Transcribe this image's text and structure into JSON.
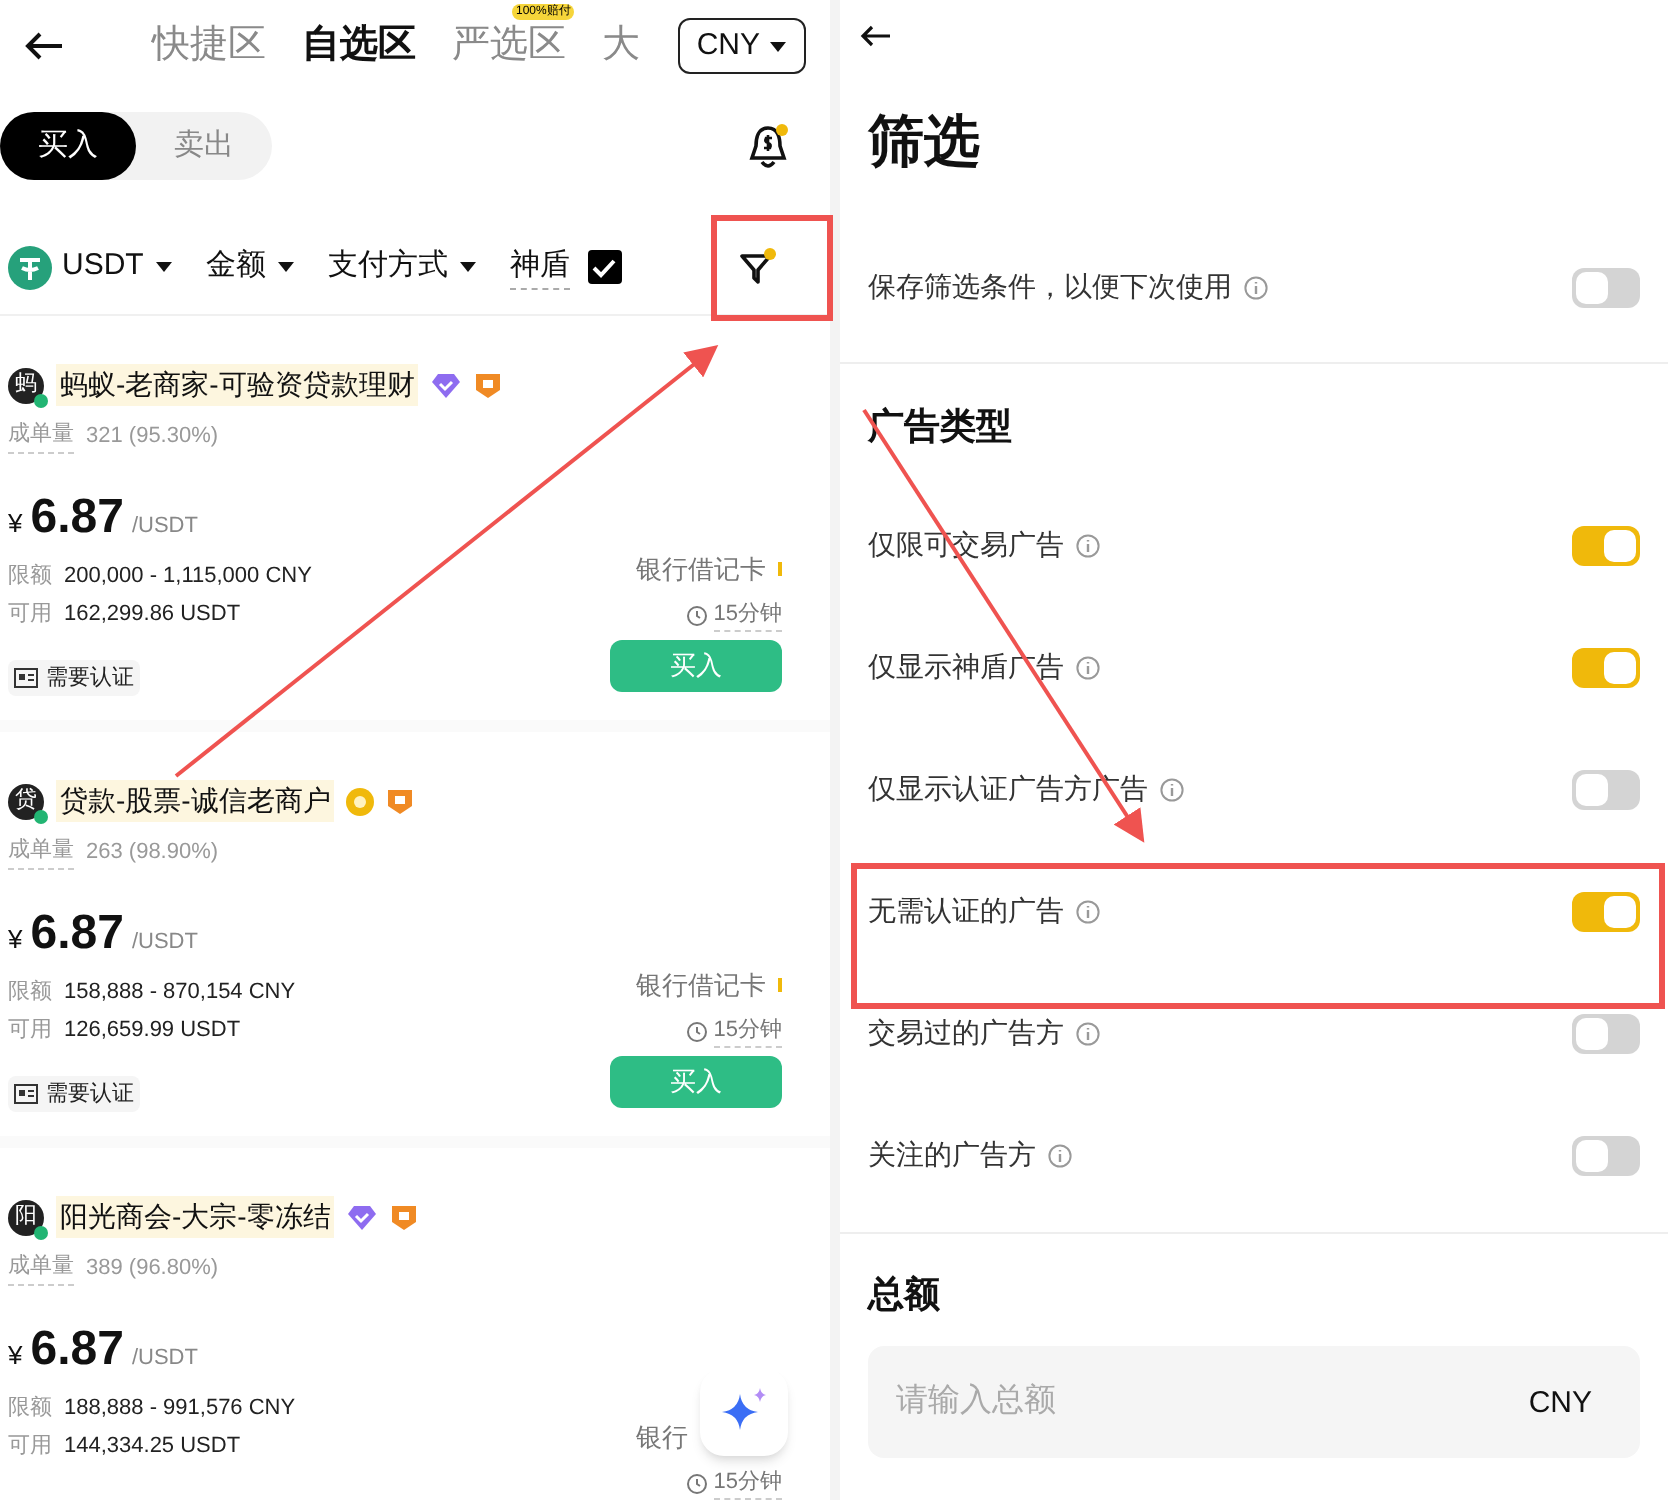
{
  "left": {
    "tabs": [
      {
        "label": "快捷区",
        "selected": false
      },
      {
        "label": "自选区",
        "selected": true
      },
      {
        "label": "严选区",
        "selected": false,
        "badge": "100%赔付"
      },
      {
        "label": "大",
        "selected": false
      }
    ],
    "currency": "CNY",
    "sides": [
      {
        "label": "买入",
        "selected": true
      },
      {
        "label": "卖出",
        "selected": false
      }
    ],
    "filters": [
      {
        "kind": "coin",
        "label": "USDT"
      },
      {
        "kind": "dropdown",
        "label": "金额"
      },
      {
        "kind": "dropdown",
        "label": "支付方式"
      },
      {
        "kind": "checkbox",
        "label": "神盾",
        "checked": true
      }
    ],
    "ads": [
      {
        "avatar": "蚂",
        "name": "蚂蚁-老商家-可验资贷款理财",
        "badges": [
          {
            "kind": "diamond"
          },
          {
            "kind": "shield"
          }
        ],
        "orders_label": "成单量",
        "orders": "321 (95.30%)",
        "currency_sign": "¥",
        "price": "6.87",
        "unit": "/USDT",
        "limit_label": "限额",
        "limit": "200,000 - 1,115,000 CNY",
        "available_label": "可用",
        "available": "162,299.86 USDT",
        "payment": "银行借记卡",
        "time": "15分钟",
        "requirement": "需要认证",
        "button": "买入"
      },
      {
        "avatar": "贷",
        "name": "贷款-股票-诚信老商户",
        "badges": [
          {
            "kind": "coin"
          },
          {
            "kind": "shield"
          }
        ],
        "orders_label": "成单量",
        "orders": "263 (98.90%)",
        "currency_sign": "¥",
        "price": "6.87",
        "unit": "/USDT",
        "limit_label": "限额",
        "limit": "158,888 - 870,154 CNY",
        "available_label": "可用",
        "available": "126,659.99 USDT",
        "payment": "银行借记卡",
        "time": "15分钟",
        "requirement": "需要认证",
        "button": "买入"
      },
      {
        "avatar": "阳",
        "name": "阳光商会-大宗-零冻结",
        "badges": [
          {
            "kind": "diamond"
          },
          {
            "kind": "shield"
          }
        ],
        "orders_label": "成单量",
        "orders": "389 (96.80%)",
        "currency_sign": "¥",
        "price": "6.87",
        "unit": "/USDT",
        "limit_label": "限额",
        "limit": "188,888 - 991,576 CNY",
        "available_label": "可用",
        "available": "144,334.25 USDT",
        "payment": "银行",
        "time": "15分钟"
      }
    ]
  },
  "right": {
    "title": "筛选",
    "save_option": {
      "label": "保存筛选条件，以便下次使用",
      "on": false
    },
    "sections": [
      {
        "title": "广告类型",
        "options": [
          {
            "label": "仅限可交易广告",
            "on": true
          },
          {
            "label": "仅显示神盾广告",
            "on": true
          },
          {
            "label": "仅显示认证广告方广告",
            "on": false
          },
          {
            "label": "无需认证的广告",
            "on": true
          },
          {
            "label": "交易过的广告方",
            "on": false
          },
          {
            "label": "关注的广告方",
            "on": false
          }
        ]
      }
    ],
    "total": {
      "title": "总额",
      "placeholder": "请输入总额",
      "currency": "CNY"
    }
  }
}
